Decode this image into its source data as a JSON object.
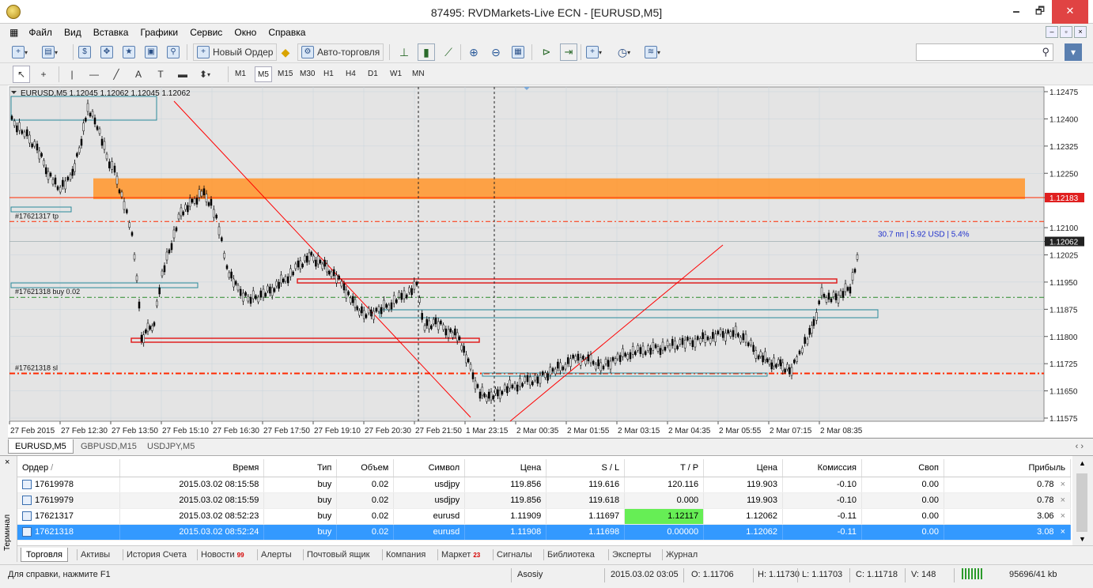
{
  "window": {
    "title": "87495: RVDMarkets-Live ECN - [EURUSD,M5]",
    "minimize": "🗕",
    "maximize": "🗗",
    "close": "✕"
  },
  "menu": [
    {
      "label": "Файл"
    },
    {
      "label": "Вид"
    },
    {
      "label": "Вставка"
    },
    {
      "label": "Графики"
    },
    {
      "label": "Сервис"
    },
    {
      "label": "Окно"
    },
    {
      "label": "Справка"
    }
  ],
  "toolbar": {
    "new_order": "Новый Ордер",
    "auto_trading": "Авто-торговля",
    "search_placeholder": ""
  },
  "timeframes": [
    "M1",
    "M5",
    "M15",
    "M30",
    "H1",
    "H4",
    "D1",
    "W1",
    "MN"
  ],
  "active_timeframe": "M5",
  "chart": {
    "header": "EURUSD,M5  1.12045 1.12062 1.12045 1.12062",
    "profit_label": "30.7 пп | 5.92 USD | 5.4%",
    "order_labels": {
      "tp": "#17621317 tp",
      "buy": "#17621318 buy 0.02",
      "sl": "#17621318 sl"
    },
    "price_ticks": [
      "1.12475",
      "1.12400",
      "1.12325",
      "1.12250",
      "1.12183",
      "1.12100",
      "1.12062",
      "1.12025",
      "1.11950",
      "1.11875",
      "1.11800",
      "1.11725",
      "1.11650",
      "1.11575"
    ],
    "time_ticks": [
      "27 Feb 2015",
      "27 Feb 12:30",
      "27 Feb 13:50",
      "27 Feb 15:10",
      "27 Feb 16:30",
      "27 Feb 17:50",
      "27 Feb 19:10",
      "27 Feb 20:30",
      "27 Feb 21:50",
      "1 Mar 23:15",
      "2 Mar 00:35",
      "2 Mar 01:55",
      "2 Mar 03:15",
      "2 Mar 04:35",
      "2 Mar 05:55",
      "2 Mar 07:15",
      "2 Mar 08:35"
    ],
    "colors": {
      "bg": "#ffffff",
      "grid": "#c8d4dc",
      "candle": "#000000",
      "orange_zone": "#ff9933",
      "red_line": "#ff2a00",
      "green_line": "#2a8a2a",
      "teal_box": "#2a8a9a",
      "red_box": "#e02020",
      "trend": "#ff0000"
    }
  },
  "chart_tabs": [
    "EURUSD,M5",
    "GBPUSD,M15",
    "USDJPY,M5"
  ],
  "terminal": {
    "side_label": "Терминал",
    "close_glyph": "×",
    "columns": [
      "Ордер",
      "Время",
      "Тип",
      "Объем",
      "Символ",
      "Цена",
      "S / L",
      "T / P",
      "Цена",
      "Комиссия",
      "Своп",
      "Прибыль"
    ],
    "rows": [
      {
        "order": "17619978",
        "time": "2015.03.02 08:15:58",
        "type": "buy",
        "volume": "0.02",
        "symbol": "usdjpy",
        "price": "119.856",
        "sl": "119.616",
        "tp": "120.116",
        "cur_price": "119.903",
        "commission": "-0.10",
        "swap": "0.00",
        "profit": "0.78"
      },
      {
        "order": "17619979",
        "time": "2015.03.02 08:15:59",
        "type": "buy",
        "volume": "0.02",
        "symbol": "usdjpy",
        "price": "119.856",
        "sl": "119.618",
        "tp": "0.000",
        "cur_price": "119.903",
        "commission": "-0.10",
        "swap": "0.00",
        "profit": "0.78"
      },
      {
        "order": "17621317",
        "time": "2015.03.02 08:52:23",
        "type": "buy",
        "volume": "0.02",
        "symbol": "eurusd",
        "price": "1.11909",
        "sl": "1.11697",
        "tp": "1.12117",
        "cur_price": "1.12062",
        "commission": "-0.11",
        "swap": "0.00",
        "profit": "3.06"
      },
      {
        "order": "17621318",
        "time": "2015.03.02 08:52:24",
        "type": "buy",
        "volume": "0.02",
        "symbol": "eurusd",
        "price": "1.11908",
        "sl": "1.11698",
        "tp": "0.00000",
        "cur_price": "1.12062",
        "commission": "-0.11",
        "swap": "0.00",
        "profit": "3.08"
      }
    ],
    "tabs": [
      {
        "label": "Торговля"
      },
      {
        "label": "Активы"
      },
      {
        "label": "История Счета"
      },
      {
        "label": "Новости",
        "badge": "99"
      },
      {
        "label": "Алерты"
      },
      {
        "label": "Почтовый ящик"
      },
      {
        "label": "Компания"
      },
      {
        "label": "Маркет",
        "badge": "23"
      },
      {
        "label": "Сигналы"
      },
      {
        "label": "Библиотека"
      },
      {
        "label": "Эксперты"
      },
      {
        "label": "Журнал"
      }
    ]
  },
  "status": {
    "help": "Для справки, нажмите F1",
    "profile": "Asosiy",
    "datetime": "2015.03.02 03:05",
    "open": "O: 1.11706",
    "high": "H: 1.11730",
    "low": "L: 1.11703",
    "close": "C: 1.11718",
    "volume": "V: 148",
    "traffic": "95696/41 kb"
  }
}
